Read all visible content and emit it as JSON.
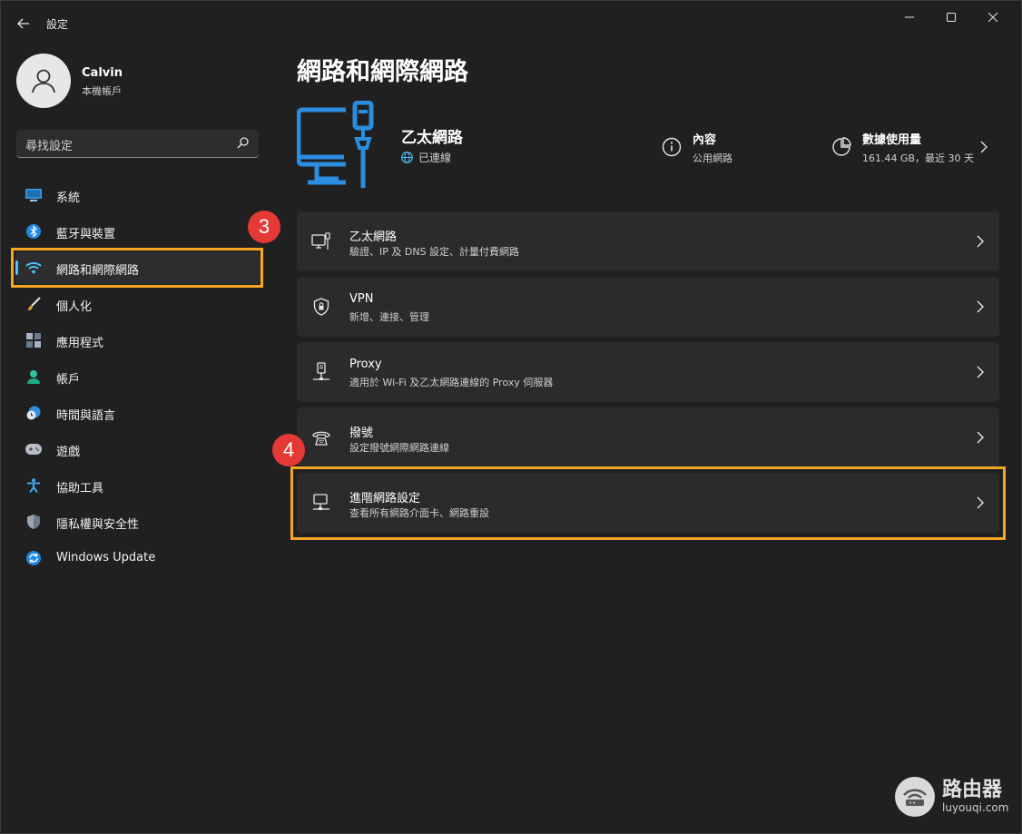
{
  "window": {
    "title": "設定"
  },
  "profile": {
    "name": "Calvin",
    "account": "本機帳戶"
  },
  "search": {
    "placeholder": "尋找設定"
  },
  "sidebar": {
    "items": [
      {
        "label": "系統",
        "icon": "monitor-icon"
      },
      {
        "label": "藍牙與裝置",
        "icon": "bluetooth-icon"
      },
      {
        "label": "網路和網際網路",
        "icon": "wifi-icon",
        "active": true
      },
      {
        "label": "個人化",
        "icon": "brush-icon"
      },
      {
        "label": "應用程式",
        "icon": "apps-icon"
      },
      {
        "label": "帳戶",
        "icon": "person-icon"
      },
      {
        "label": "時間與語言",
        "icon": "clock-globe-icon"
      },
      {
        "label": "遊戲",
        "icon": "gamepad-icon"
      },
      {
        "label": "協助工具",
        "icon": "accessibility-icon"
      },
      {
        "label": "隱私權與安全性",
        "icon": "shield-icon"
      },
      {
        "label": "Windows Update",
        "icon": "update-icon"
      }
    ]
  },
  "annotations": {
    "step3": "3",
    "step4": "4"
  },
  "main": {
    "title": "網路和網際網路",
    "hero": {
      "name": "乙太網路",
      "status": "已連線"
    },
    "properties": {
      "title": "內容",
      "sub": "公用網路"
    },
    "usage": {
      "title": "數據使用量",
      "sub": "161.44 GB，最近 30 天"
    },
    "cards": [
      {
        "title": "乙太網路",
        "sub": "驗證、IP 及 DNS 設定、計量付費網路",
        "icon": "ethernet-icon"
      },
      {
        "title": "VPN",
        "sub": "新增、連接、管理",
        "icon": "vpn-shield-icon"
      },
      {
        "title": "Proxy",
        "sub": "適用於 Wi-Fi 及乙太網路連線的 Proxy 伺服器",
        "icon": "proxy-icon"
      },
      {
        "title": "撥號",
        "sub": "設定撥號網際網路連線",
        "icon": "dialup-icon"
      },
      {
        "title": "進階網路設定",
        "sub": "查看所有網路介面卡、網路重設",
        "icon": "network-adapter-icon"
      }
    ]
  },
  "watermark": {
    "cn": "路由器",
    "en": "luyouqi.com"
  },
  "colors": {
    "accent": "#4cc2ff",
    "highlight": "#f5a623",
    "badge": "#e53935"
  }
}
